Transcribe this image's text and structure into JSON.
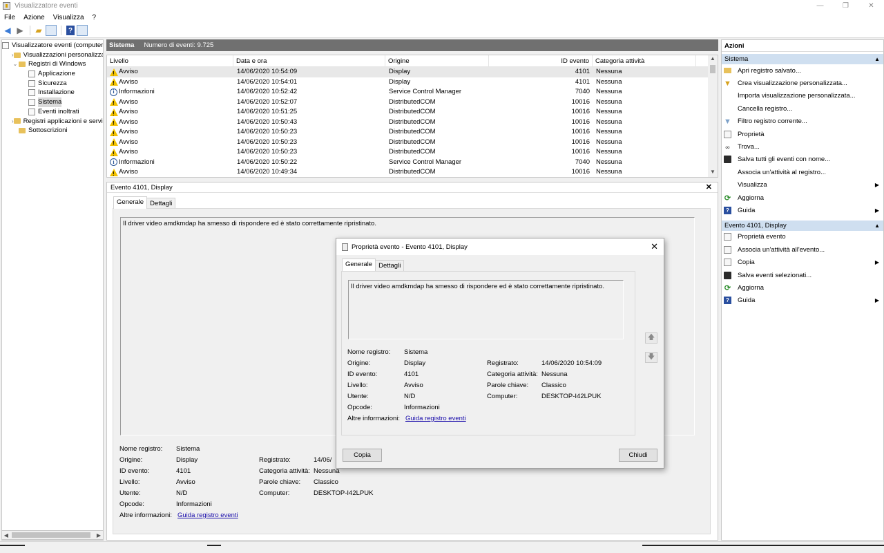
{
  "window": {
    "title": "Visualizzatore eventi"
  },
  "menu": [
    "File",
    "Azione",
    "Visualizza",
    "?"
  ],
  "tree": [
    {
      "label": "Visualizzatore eventi (computer",
      "level": 0,
      "exp": "",
      "icon": "log"
    },
    {
      "label": "Visualizzazioni personalizzate",
      "level": 1,
      "exp": "›",
      "icon": "fold"
    },
    {
      "label": "Registri di Windows",
      "level": 1,
      "exp": "⌄",
      "icon": "fold"
    },
    {
      "label": "Applicazione",
      "level": 2,
      "exp": "",
      "icon": "log"
    },
    {
      "label": "Sicurezza",
      "level": 2,
      "exp": "",
      "icon": "log"
    },
    {
      "label": "Installazione",
      "level": 2,
      "exp": "",
      "icon": "log"
    },
    {
      "label": "Sistema",
      "level": 2,
      "exp": "",
      "icon": "log",
      "selected": true
    },
    {
      "label": "Eventi inoltrati",
      "level": 2,
      "exp": "",
      "icon": "log"
    },
    {
      "label": "Registri applicazioni e servizi",
      "level": 1,
      "exp": "›",
      "icon": "fold"
    },
    {
      "label": "Sottoscrizioni",
      "level": 1,
      "exp": "",
      "icon": "fold"
    }
  ],
  "center": {
    "log_name": "Sistema",
    "count": "Numero di eventi: 9.725"
  },
  "columns": [
    "Livello",
    "Data e ora",
    "Origine",
    "ID evento",
    "Categoria attività"
  ],
  "events": [
    {
      "level": "Avviso",
      "type": "warn",
      "date": "14/06/2020 10:54:09",
      "source": "Display",
      "id": "4101",
      "cat": "Nessuna"
    },
    {
      "level": "Avviso",
      "type": "warn",
      "date": "14/06/2020 10:54:01",
      "source": "Display",
      "id": "4101",
      "cat": "Nessuna"
    },
    {
      "level": "Informazioni",
      "type": "info",
      "date": "14/06/2020 10:52:42",
      "source": "Service Control Manager",
      "id": "7040",
      "cat": "Nessuna"
    },
    {
      "level": "Avviso",
      "type": "warn",
      "date": "14/06/2020 10:52:07",
      "source": "DistributedCOM",
      "id": "10016",
      "cat": "Nessuna"
    },
    {
      "level": "Avviso",
      "type": "warn",
      "date": "14/06/2020 10:51:25",
      "source": "DistributedCOM",
      "id": "10016",
      "cat": "Nessuna"
    },
    {
      "level": "Avviso",
      "type": "warn",
      "date": "14/06/2020 10:50:43",
      "source": "DistributedCOM",
      "id": "10016",
      "cat": "Nessuna"
    },
    {
      "level": "Avviso",
      "type": "warn",
      "date": "14/06/2020 10:50:23",
      "source": "DistributedCOM",
      "id": "10016",
      "cat": "Nessuna"
    },
    {
      "level": "Avviso",
      "type": "warn",
      "date": "14/06/2020 10:50:23",
      "source": "DistributedCOM",
      "id": "10016",
      "cat": "Nessuna"
    },
    {
      "level": "Avviso",
      "type": "warn",
      "date": "14/06/2020 10:50:23",
      "source": "DistributedCOM",
      "id": "10016",
      "cat": "Nessuna"
    },
    {
      "level": "Informazioni",
      "type": "info",
      "date": "14/06/2020 10:50:22",
      "source": "Service Control Manager",
      "id": "7040",
      "cat": "Nessuna"
    },
    {
      "level": "Avviso",
      "type": "warn",
      "date": "14/06/2020 10:49:34",
      "source": "DistributedCOM",
      "id": "10016",
      "cat": "Nessuna"
    }
  ],
  "detail": {
    "header": "Evento 4101, Display",
    "tab_general": "Generale",
    "tab_details": "Dettagli",
    "message": "Il driver video amdkmdap ha smesso di rispondere ed è stato correttamente ripristinato.",
    "labels": {
      "log_name": "Nome registro:",
      "source": "Origine:",
      "event_id": "ID evento:",
      "level": "Livello:",
      "user": "Utente:",
      "opcode": "Opcode:",
      "more_info": "Altre informazioni:",
      "logged": "Registrato:",
      "task_category": "Categoria attività:",
      "keywords": "Parole chiave:",
      "computer": "Computer:"
    },
    "values": {
      "log_name": "Sistema",
      "source": "Display",
      "event_id": "4101",
      "level": "Avviso",
      "user": "N/D",
      "opcode": "Informazioni",
      "more_info_link": "Guida registro eventi",
      "logged": "14/06/2020 10:54:09",
      "logged_partial": "14/06/",
      "task_category": "Nessuna",
      "keywords": "Classico",
      "computer": "DESKTOP-I42LPUK"
    }
  },
  "actions": {
    "title": "Azioni",
    "section1": "Sistema",
    "items1": [
      {
        "label": "Apri registro salvato...",
        "icon": "folder"
      },
      {
        "label": "Crea visualizzazione personalizzata...",
        "icon": "filter"
      },
      {
        "label": "Importa visualizzazione personalizzata...",
        "icon": "plain"
      },
      {
        "label": "Cancella registro...",
        "icon": "plain"
      },
      {
        "label": "Filtro registro corrente...",
        "icon": "filt2"
      },
      {
        "label": "Proprietà",
        "icon": "page"
      },
      {
        "label": "Trova...",
        "icon": "bino"
      },
      {
        "label": "Salva tutti gli eventi con nome...",
        "icon": "disk"
      },
      {
        "label": "Associa un'attività al registro...",
        "icon": "plain"
      },
      {
        "label": "Visualizza",
        "icon": "plain",
        "sub": true
      },
      {
        "label": "Aggiorna",
        "icon": "refresh"
      },
      {
        "label": "Guida",
        "icon": "help",
        "sub": true
      }
    ],
    "section2": "Evento 4101, Display",
    "items2": [
      {
        "label": "Proprietà evento",
        "icon": "page"
      },
      {
        "label": "Associa un'attività all'evento...",
        "icon": "page"
      },
      {
        "label": "Copia",
        "icon": "page",
        "sub": true
      },
      {
        "label": "Salva eventi selezionati...",
        "icon": "disk"
      },
      {
        "label": "Aggiorna",
        "icon": "refresh"
      },
      {
        "label": "Guida",
        "icon": "help",
        "sub": true
      }
    ]
  },
  "dialog": {
    "title": "Proprietà evento - Evento 4101, Display",
    "copy_label": "Copia",
    "close_label": "Chiudi"
  }
}
